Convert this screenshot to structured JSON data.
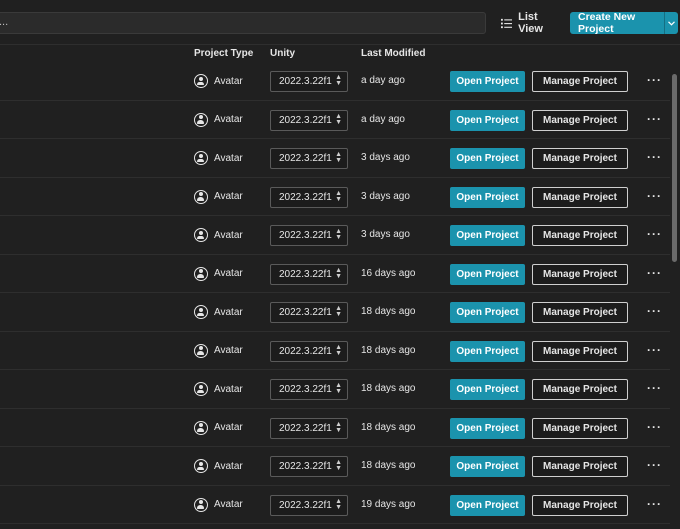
{
  "search": {
    "value": "..."
  },
  "toolbar": {
    "list_view_label": "List View",
    "create_label": "Create New Project"
  },
  "columns": {
    "project_type": "Project Type",
    "unity": "Unity",
    "last_modified": "Last Modified",
    "sort_indicator": "↑"
  },
  "row_actions": {
    "open": "Open Project",
    "manage": "Manage Project",
    "more": "···"
  },
  "rows": [
    {
      "type": "Avatar",
      "unity": "2022.3.22f1",
      "modified": "a day ago"
    },
    {
      "type": "Avatar",
      "unity": "2022.3.22f1",
      "modified": "a day ago"
    },
    {
      "type": "Avatar",
      "unity": "2022.3.22f1",
      "modified": "3 days ago"
    },
    {
      "type": "Avatar",
      "unity": "2022.3.22f1",
      "modified": "3 days ago"
    },
    {
      "type": "Avatar",
      "unity": "2022.3.22f1",
      "modified": "3 days ago"
    },
    {
      "type": "Avatar",
      "unity": "2022.3.22f1",
      "modified": "16 days ago"
    },
    {
      "type": "Avatar",
      "unity": "2022.3.22f1",
      "modified": "18 days ago"
    },
    {
      "type": "Avatar",
      "unity": "2022.3.22f1",
      "modified": "18 days ago"
    },
    {
      "type": "Avatar",
      "unity": "2022.3.22f1",
      "modified": "18 days ago"
    },
    {
      "type": "Avatar",
      "unity": "2022.3.22f1",
      "modified": "18 days ago"
    },
    {
      "type": "Avatar",
      "unity": "2022.3.22f1",
      "modified": "18 days ago"
    },
    {
      "type": "Avatar",
      "unity": "2022.3.22f1",
      "modified": "19 days ago"
    }
  ],
  "colors": {
    "accent": "#1b93ad",
    "background": "#202020"
  }
}
